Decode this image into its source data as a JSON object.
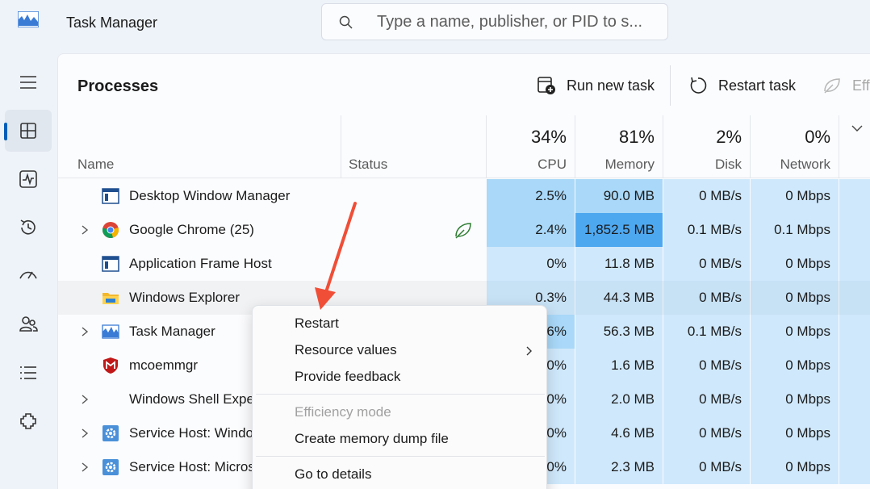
{
  "window": {
    "title": "Task Manager"
  },
  "search": {
    "placeholder": "Type a name, publisher, or PID to s..."
  },
  "nav": {
    "items": [
      {
        "name": "menu-icon"
      },
      {
        "name": "processes-icon",
        "active": true
      },
      {
        "name": "performance-icon"
      },
      {
        "name": "app-history-icon"
      },
      {
        "name": "startup-apps-icon"
      },
      {
        "name": "users-icon"
      },
      {
        "name": "details-icon"
      },
      {
        "name": "services-icon"
      }
    ]
  },
  "page": {
    "title": "Processes"
  },
  "toolbar": {
    "run_new_task": "Run new task",
    "restart_task": "Restart task",
    "efficiency": "Eff"
  },
  "table": {
    "columns": {
      "name": "Name",
      "status": "Status",
      "cpu": {
        "pct": "34%",
        "label": "CPU"
      },
      "memory": {
        "pct": "81%",
        "label": "Memory"
      },
      "disk": {
        "pct": "2%",
        "label": "Disk"
      },
      "network": {
        "pct": "0%",
        "label": "Network"
      }
    },
    "rows": [
      {
        "name": "Desktop Window Manager",
        "cpu": "2.5%",
        "memory": "90.0 MB",
        "disk": "0 MB/s",
        "network": "0 Mbps"
      },
      {
        "name": "Google Chrome (25)",
        "cpu": "2.4%",
        "memory": "1,852.5 MB",
        "disk": "0.1 MB/s",
        "network": "0.1 Mbps"
      },
      {
        "name": "Application Frame Host",
        "cpu": "0%",
        "memory": "11.8 MB",
        "disk": "0 MB/s",
        "network": "0 Mbps"
      },
      {
        "name": "Windows Explorer",
        "cpu": "0.3%",
        "memory": "44.3 MB",
        "disk": "0 MB/s",
        "network": "0 Mbps"
      },
      {
        "name": "Task Manager",
        "cpu": "1.6%",
        "memory": "56.3 MB",
        "disk": "0.1 MB/s",
        "network": "0 Mbps"
      },
      {
        "name": "mcoemmgr",
        "cpu": "0%",
        "memory": "1.6 MB",
        "disk": "0 MB/s",
        "network": "0 Mbps"
      },
      {
        "name": "Windows Shell Experience Host",
        "cpu": "0%",
        "memory": "2.0 MB",
        "disk": "0 MB/s",
        "network": "0 Mbps"
      },
      {
        "name": "Service Host: Windows Update",
        "cpu": "0%",
        "memory": "4.6 MB",
        "disk": "0 MB/s",
        "network": "0 Mbps"
      },
      {
        "name": "Service Host: Microsoft",
        "cpu": "0%",
        "memory": "2.3 MB",
        "disk": "0 MB/s",
        "network": "0 Mbps"
      }
    ]
  },
  "context_menu": {
    "items": [
      {
        "label": "Restart"
      },
      {
        "label": "Resource values",
        "submenu": true
      },
      {
        "label": "Provide feedback"
      },
      {
        "label": "Efficiency mode",
        "disabled": true
      },
      {
        "label": "Create memory dump file"
      },
      {
        "label": "Go to details"
      }
    ]
  },
  "colors": {
    "accent": "#005fb8",
    "heat_light": "#cfe8fb",
    "heat_mid": "#a9d8f8",
    "heat_strong": "#7fc7f7",
    "heat_hot": "#4ea8f0",
    "arrow": "#f04e37"
  }
}
